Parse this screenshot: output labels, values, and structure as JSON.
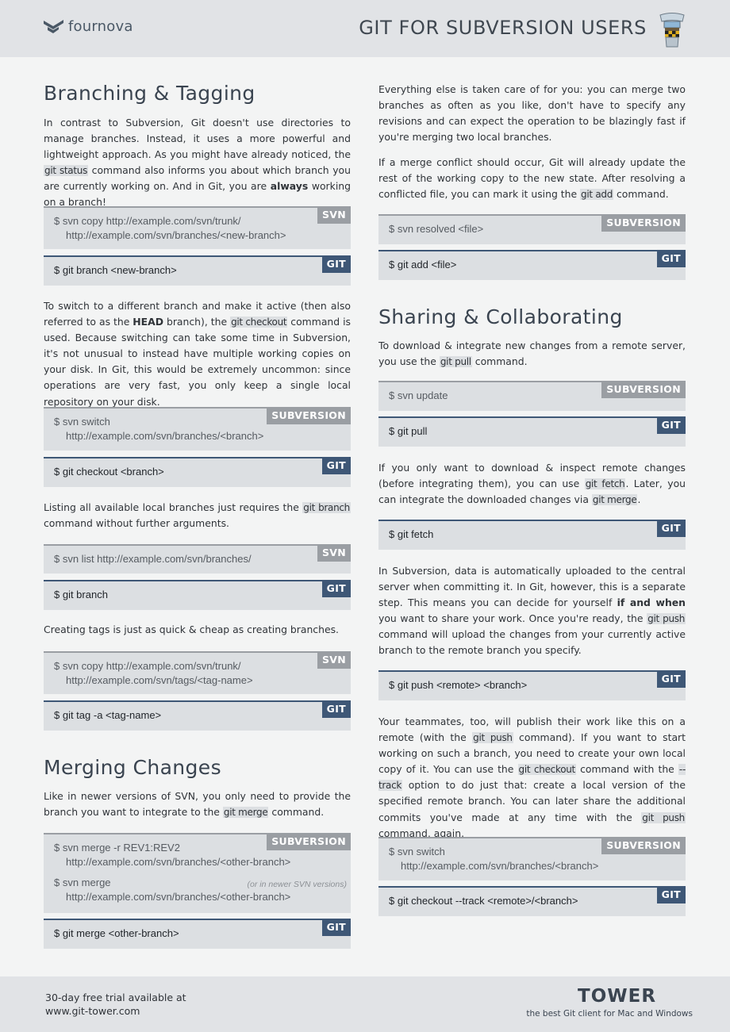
{
  "header": {
    "logo_text": "fournova",
    "title": "GIT FOR SUBVERSION USERS"
  },
  "left": {
    "branching": {
      "heading": "Branching & Tagging",
      "p1": {
        "a": "In contrast to Subversion, Git doesn't use directories to manage branches. Instead, it uses a more powerful and lightweight approach. As you might have already noticed, the ",
        "code": "git status",
        "b": " command also informs you about which branch you are currently working on. And in Git, you are ",
        "bold": "always",
        "c": " working on a branch!"
      },
      "box1": {
        "tag": "SVN",
        "line1": "$ svn copy http://example.com/svn/trunk/",
        "line2": "http://example.com/svn/branches/<new-branch>"
      },
      "box2": {
        "tag": "GIT",
        "line1": "$ git branch <new-branch>"
      },
      "p2": {
        "a": "To switch to a different branch and make it active (then also referred to as the ",
        "bold": "HEAD",
        "b": " branch), the ",
        "code": "git checkout",
        "c": " command is used. Because switching can take some time in Subversion, it's not unusual to instead have multiple working copies on your disk. In Git, this would be extremely uncommon: since operations are very fast, you only keep a single local repository on your disk."
      },
      "box3": {
        "tag": "SUBVERSION",
        "line1": "$ svn switch",
        "line2": "http://example.com/svn/branches/<branch>"
      },
      "box4": {
        "tag": "GIT",
        "line1": "$ git checkout <branch>"
      },
      "p3": {
        "a": "Listing all available local branches just requires the ",
        "code": "git branch",
        "b": " command without further arguments."
      },
      "box5": {
        "tag": "SVN",
        "line1": "$ svn list http://example.com/svn/branches/"
      },
      "box6": {
        "tag": "GIT",
        "line1": "$ git branch"
      },
      "p4": "Creating tags is just as quick & cheap as creating branches.",
      "box7": {
        "tag": "SVN",
        "line1": "$ svn copy http://example.com/svn/trunk/",
        "line2": "http://example.com/svn/tags/<tag-name>"
      },
      "box8": {
        "tag": "GIT",
        "line1": "$ git tag -a <tag-name>"
      }
    },
    "merging": {
      "heading": "Merging Changes",
      "p1": {
        "a": "Like in newer versions of SVN, you only need to provide the branch you want to integrate to the ",
        "code": "git merge",
        "b": " command."
      },
      "box1": {
        "tag": "SUBVERSION",
        "line1": "$ svn merge -r REV1:REV2",
        "line2": "http://example.com/svn/branches/<other-branch>",
        "line3": "$ svn merge",
        "note": "(or in newer SVN versions)",
        "line4": "http://example.com/svn/branches/<other-branch>"
      },
      "box2": {
        "tag": "GIT",
        "line1": "$ git merge <other-branch>"
      }
    }
  },
  "right": {
    "p1": "Everything else is taken care of for you: you can merge two branches as often as you like, don't have to specify any revisions and can expect the operation to be blazingly fast if you're merging two local branches.",
    "p2": {
      "a": "If a merge conflict should occur, Git will already update the rest of the working copy to the new state. After resolving a conflicted file, you can mark it using the ",
      "code": "git add",
      "b": " command."
    },
    "box1": {
      "tag": "SUBVERSION",
      "line1": "$ svn resolved <file>"
    },
    "box2": {
      "tag": "GIT",
      "line1": "$ git add <file>"
    },
    "sharing": {
      "heading": "Sharing & Collaborating",
      "p1": {
        "a": "To download & integrate new changes from a remote server, you use the ",
        "code": "git pull",
        "b": " command."
      },
      "box1": {
        "tag": "SUBVERSION",
        "line1": "$ svn update"
      },
      "box2": {
        "tag": "GIT",
        "line1": "$ git pull"
      },
      "p2": {
        "a": "If you only want to download & inspect remote changes (before integrating them), you can use ",
        "code1": "git fetch",
        "b": ". Later, you can integrate the downloaded changes via ",
        "code2": "git merge",
        "c": "."
      },
      "box3": {
        "tag": "GIT",
        "line1": "$ git fetch"
      },
      "p3": {
        "a": "In Subversion, data is automatically uploaded to the central server when committing it. In Git, however, this is a separate step. This means you can decide for yourself ",
        "bold": "if and when",
        "b": " you want to share your work. Once you're ready, the ",
        "code": "git push",
        "c": " command will upload the changes from your currently active branch to the remote branch you specify."
      },
      "box4": {
        "tag": "GIT",
        "line1": "$ git push <remote> <branch>"
      },
      "p4": {
        "a": "Your teammates, too, will publish their work like this on a remote (with the ",
        "code1": "git push",
        "b": " command). If you want to start working on such a branch, you need to create your own local copy of it. You can use the ",
        "code2": "git checkout",
        "c": " command with the ",
        "code3": "--track",
        "d": " option to do just that: create a local version of the specified remote branch. You can later share the additional commits you've made at any time with the ",
        "code4": "git push",
        "e": " command, again."
      },
      "box5": {
        "tag": "SUBVERSION",
        "line1": "$ svn switch",
        "line2": "http://example.com/svn/branches/<branch>"
      },
      "box6": {
        "tag": "GIT",
        "line1": "$ git checkout --track <remote>/<branch>"
      }
    }
  },
  "footer": {
    "line1": "30-day free trial available at",
    "line2": "www.git-tower.com",
    "brand": "TOWER",
    "tagline": "the best Git client for Mac and Windows"
  },
  "colors": {
    "git_accent": "#3e5776",
    "svn_gray": "#9a9ea3",
    "box_bg": "#dcdfe2"
  }
}
